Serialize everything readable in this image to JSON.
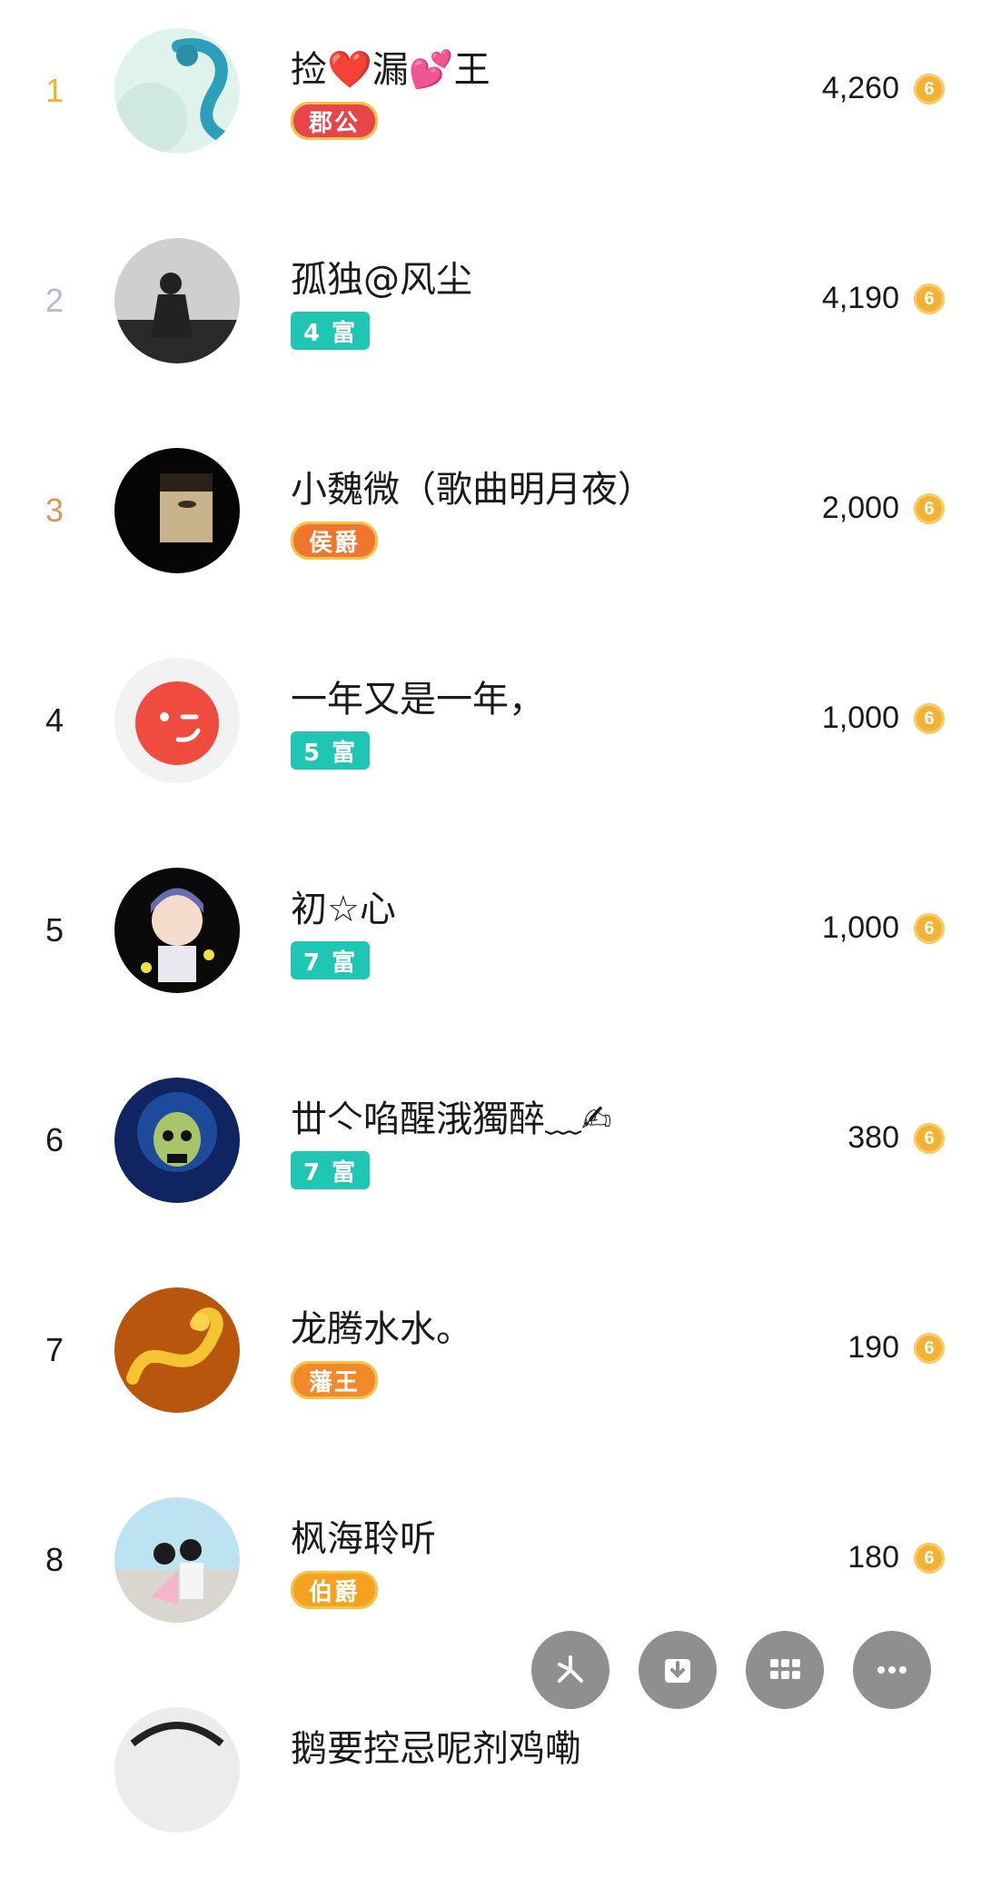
{
  "leaderboard": [
    {
      "rank": "1",
      "rank_color": "#f0b52a",
      "name": "捡❤️漏💕王",
      "badge": "郡公",
      "badge_style": "title",
      "badge_color": "#e8454b",
      "score": "4,260",
      "avatar_icon": "dragon-avatar"
    },
    {
      "rank": "2",
      "rank_color": "#b6b6e0",
      "name": "孤独@风尘",
      "badge": "4 富",
      "badge_style": "teal",
      "score": "4,190",
      "avatar_icon": "silhouette-avatar"
    },
    {
      "rank": "3",
      "rank_color": "#d9975a",
      "name": "小魏微（歌曲明月夜）",
      "badge": "侯爵",
      "badge_style": "title",
      "badge_color": "#f0762f",
      "score": "2,000",
      "avatar_icon": "face-avatar"
    },
    {
      "rank": "4",
      "rank_color": "#1a1a1a",
      "name": "一年又是一年，",
      "badge": "5 富",
      "badge_style": "teal",
      "score": "1,000",
      "avatar_icon": "wink-avatar"
    },
    {
      "rank": "5",
      "rank_color": "#1a1a1a",
      "name": "初☆心",
      "badge": "7 富",
      "badge_style": "teal",
      "score": "1,000",
      "avatar_icon": "anime-boy-avatar"
    },
    {
      "rank": "6",
      "rank_color": "#1a1a1a",
      "name": "丗亽啗醒涐獨醉﹏✍",
      "badge": "7 富",
      "badge_style": "teal",
      "score": "380",
      "avatar_icon": "skull-avatar"
    },
    {
      "rank": "7",
      "rank_color": "#1a1a1a",
      "name": "龙腾水水。",
      "badge": "藩王",
      "badge_style": "title",
      "badge_color": "#f28a2b",
      "score": "190",
      "avatar_icon": "gold-dragon-avatar"
    },
    {
      "rank": "8",
      "rank_color": "#1a1a1a",
      "name": "枫海聆听",
      "badge": "伯爵",
      "badge_style": "title",
      "badge_color": "#f4a21f",
      "score": "180",
      "avatar_icon": "couple-avatar"
    },
    {
      "rank": "",
      "rank_color": "#1a1a1a",
      "name": "鹅要控忌呢剂鸡嘞",
      "badge": "",
      "badge_style": "none",
      "score": "",
      "avatar_icon": "partial-avatar"
    }
  ],
  "coin_glyph": "6",
  "fab_buttons": [
    {
      "icon": "share-icon"
    },
    {
      "icon": "download-icon"
    },
    {
      "icon": "grid-icon"
    },
    {
      "icon": "more-icon"
    }
  ]
}
